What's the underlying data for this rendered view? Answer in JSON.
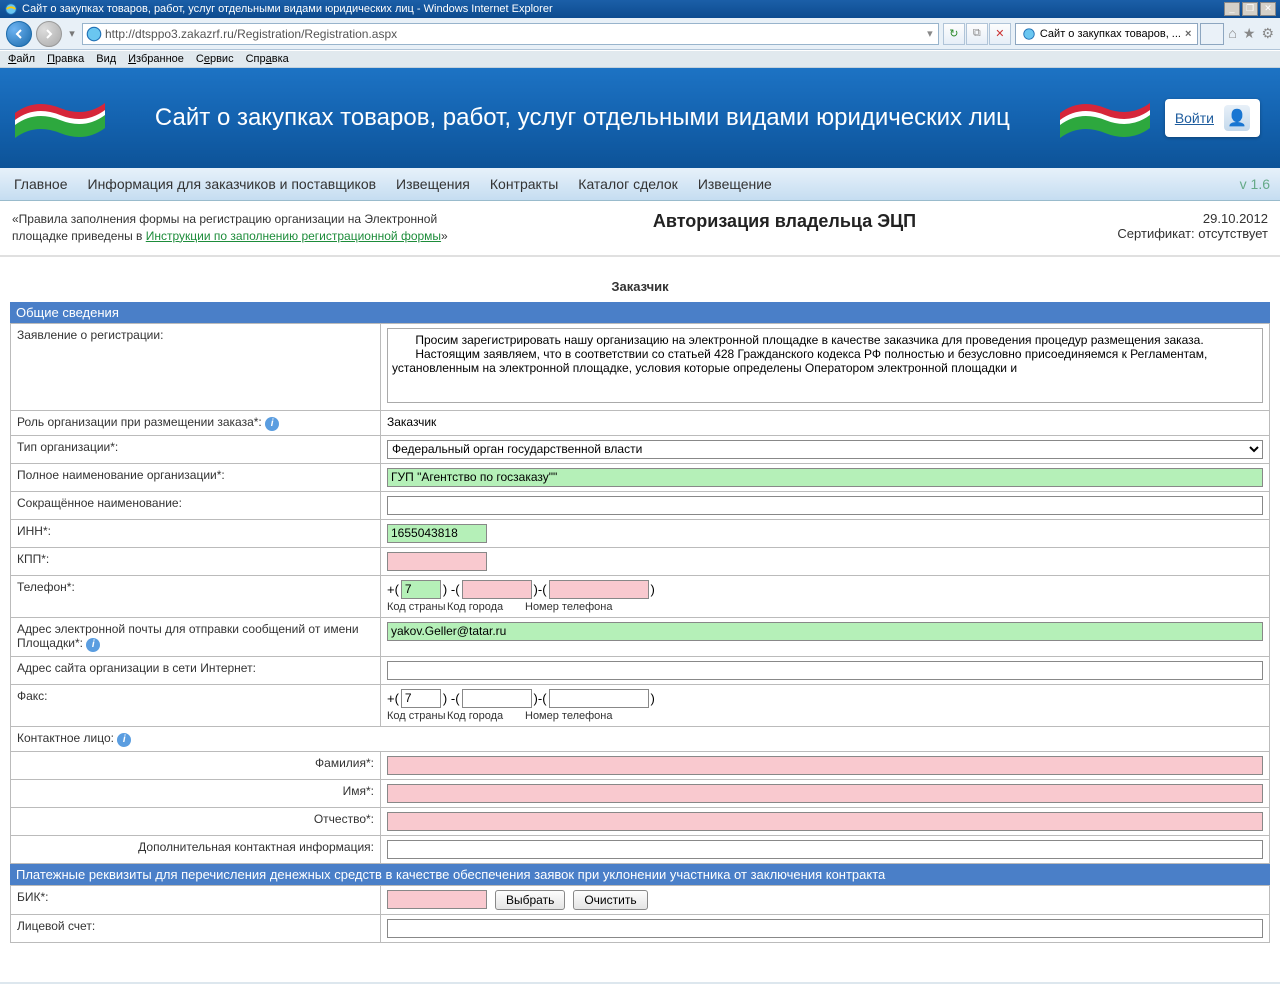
{
  "window": {
    "title": "Сайт о закупках товаров, работ, услуг отдельными видами юридических лиц - Windows Internet Explorer"
  },
  "addressbar": {
    "url": "http://dtsppo3.zakazrf.ru/Registration/Registration.aspx"
  },
  "tab": {
    "label": "Сайт о закупках товаров, ..."
  },
  "iemenu": {
    "file": "Файл",
    "edit": "Правка",
    "view": "Вид",
    "fav": "Избранное",
    "service": "Сервис",
    "help": "Справка"
  },
  "site": {
    "title": "Сайт о закупках товаров, работ, услуг отдельными видами юридических лиц",
    "login": "Войти"
  },
  "nav": {
    "items": [
      "Главное",
      "Информация для заказчиков и поставщиков",
      "Извещения",
      "Контракты",
      "Каталог сделок",
      "Извещение"
    ],
    "version": "v 1.6"
  },
  "bread": {
    "text1": "«Правила заполнения формы на регистрацию организации на Электронной площадке приведены в ",
    "link": "Инструкции по заполнению регистрационной формы",
    "text2": "»"
  },
  "pagetitle": "Авторизация владельца ЭЦП",
  "date": "29.10.2012",
  "cert": "Сертификат: отсутствует",
  "subheader": "Заказчик",
  "sections": {
    "general": "Общие сведения",
    "payment": "Платежные реквизиты для перечисления денежных средств в качестве обеспечения заявок при уклонении участника от заключения контракта"
  },
  "labels": {
    "statement": "Заявление о регистрации:",
    "role": "Роль организации при размещении заказа*:",
    "orgtype": "Тип организации*:",
    "fullname": "Полное наименование организации*:",
    "shortname": "Сокращённое наименование:",
    "inn": "ИНН*:",
    "kpp": "КПП*:",
    "phone": "Телефон*:",
    "email": "Адрес электронной почты для отправки сообщений от имени Площадки*:",
    "website": "Адрес сайта организации в сети Интернет:",
    "fax": "Факс:",
    "contact": "Контактное лицо:",
    "surname": "Фамилия*:",
    "name": "Имя*:",
    "patronymic": "Отчество*:",
    "addinfo": "Дополнительная контактная информация:",
    "bik": "БИК*:",
    "account": "Лицевой счет:",
    "country": "Код страны",
    "city": "Код города",
    "phnum": "Номер телефона"
  },
  "values": {
    "statement": "       Просим зарегистрировать нашу организацию на электронной площадке в качестве заказчика для проведения процедур размещения заказа.\n       Настоящим заявляем, что в соответствии со статьей 428 Гражданского кодекса РФ полностью и безусловно присоединяемся к Регламентам, установленным на электронной площадке, условия которые определены Оператором электронной площадки и",
    "role": "Заказчик",
    "orgtype": "Федеральный орган государственной власти",
    "fullname": "ГУП \"Агентство по госзаказу\"\"",
    "inn": "1655043818",
    "email": "yakov.Geller@tatar.ru",
    "phone_cc": "7",
    "fax_cc": "7"
  },
  "buttons": {
    "select": "Выбрать",
    "clear": "Очистить"
  }
}
